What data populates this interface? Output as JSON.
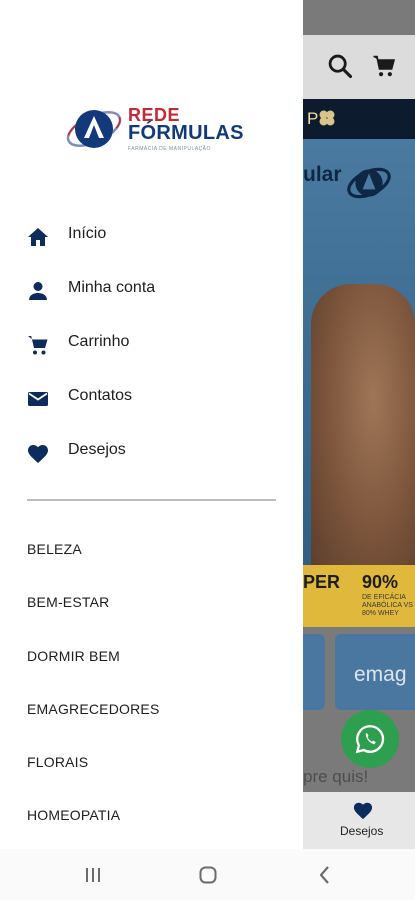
{
  "colors": {
    "brand_navy": "#0d2b5c",
    "brand_red": "#c32a36",
    "whatsapp_green": "#2e9f4e",
    "scrim_gray": "#7a7a7a"
  },
  "drawer": {
    "logo": {
      "line1": "REDE",
      "line2": "FÓRMULAS",
      "line3": "FARMÁCIA DE MANIPULAÇÃO"
    },
    "menu": [
      {
        "label": "Início",
        "icon": "home-icon"
      },
      {
        "label": "Minha conta",
        "icon": "person-icon"
      },
      {
        "label": "Carrinho",
        "icon": "cart-icon"
      },
      {
        "label": "Contatos",
        "icon": "mail-icon"
      },
      {
        "label": "Desejos",
        "icon": "heart-icon"
      }
    ],
    "categories": [
      {
        "label": "BELEZA"
      },
      {
        "label": "BEM-ESTAR"
      },
      {
        "label": "DORMIR BEM"
      },
      {
        "label": "EMAGRECEDORES"
      },
      {
        "label": "FLORAIS"
      },
      {
        "label": "HOMEOPATIA"
      }
    ]
  },
  "background": {
    "banner_title": "ular",
    "stat1": "PER",
    "stat2": "90%",
    "stat2_sub": "DE EFICÁCIA ANABÓLICA VS 80% WHEY",
    "card_text": "emag",
    "tagline": "pre quis!",
    "wishlist_label": "Desejos",
    "nav_strip_text": "P"
  }
}
